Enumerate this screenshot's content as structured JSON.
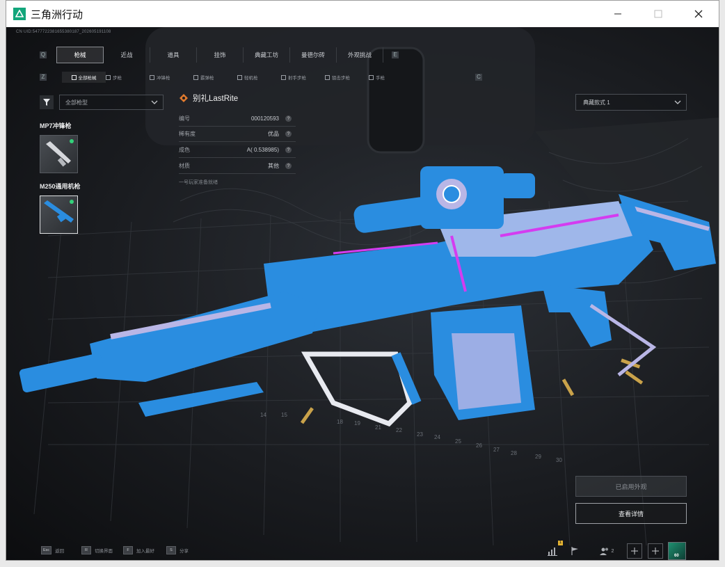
{
  "window": {
    "title": "三角洲行动"
  },
  "uid_text": "CN UID:5477722381655380187_202605191108",
  "tabs": [
    {
      "label": "枪械",
      "active": true
    },
    {
      "label": "近战",
      "active": false
    },
    {
      "label": "道具",
      "active": false
    },
    {
      "label": "挂饰",
      "active": false
    },
    {
      "label": "典藏工坊",
      "active": false
    },
    {
      "label": "曼德尔砖",
      "active": false
    },
    {
      "label": "外观挑战",
      "active": false
    }
  ],
  "subtabs": [
    {
      "label": "全部枪械",
      "active": true
    },
    {
      "label": "步枪",
      "active": false
    },
    {
      "label": "冲锋枪",
      "active": false
    },
    {
      "label": "霰弹枪",
      "active": false
    },
    {
      "label": "轻机枪",
      "active": false
    },
    {
      "label": "射手步枪",
      "active": false
    },
    {
      "label": "狙击步枪",
      "active": false
    },
    {
      "label": "手枪",
      "active": false
    }
  ],
  "filter": {
    "type_select": "全部枪型"
  },
  "weapons": [
    {
      "name": "MP7冲锋枪"
    },
    {
      "name": "M250通用机枪"
    }
  ],
  "skin": {
    "name": "别礼LastRite",
    "rows": [
      {
        "label": "编号",
        "value": "000120593"
      },
      {
        "label": "稀有度",
        "value": "优品"
      },
      {
        "label": "成色",
        "value": "A( 0.538985)"
      },
      {
        "label": "材质",
        "value": "其他"
      }
    ],
    "note": "一号玩家准备就绪"
  },
  "style_select": "典藏款式 1",
  "buttons": {
    "applied": "已启用外观",
    "detail": "查看详情"
  },
  "bottom_hints": [
    {
      "key": "Esc",
      "label": "返回"
    },
    {
      "key": "R",
      "label": "切换界面"
    },
    {
      "key": "F",
      "label": "加入最好"
    },
    {
      "key": "S",
      "label": "分享"
    }
  ],
  "status": {
    "badge": "1",
    "friends_count": "2",
    "level": "60"
  },
  "colors": {
    "accent_green": "#12a67b",
    "gun_blue": "#2a8de0",
    "gun_lavender": "#b9b6e6",
    "gun_magenta": "#d43cf0"
  }
}
